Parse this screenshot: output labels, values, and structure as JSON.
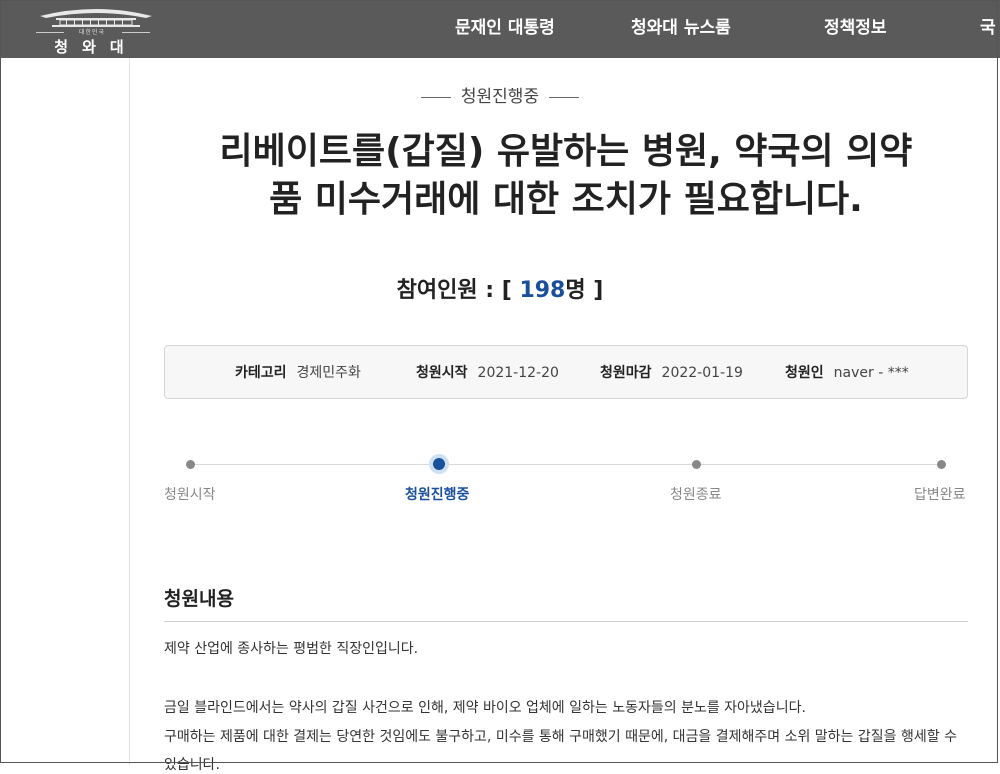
{
  "header": {
    "logo_small": "대한민국",
    "logo_name": "청와대",
    "nav": [
      "문재인 대통령",
      "청와대 뉴스룸",
      "정책정보",
      "국"
    ]
  },
  "petition": {
    "status_label": "청원진행중",
    "title_line1": "리베이트를(갑질) 유발하는 병원, 약국의 의약",
    "title_line2": "품 미수거래에 대한 조치가 필요합니다.",
    "participants_label": "참여인원 : [ ",
    "participants_count": "198",
    "participants_suffix": "명 ]",
    "info": {
      "category_key": "카테고리",
      "category_val": "경제민주화",
      "start_key": "청원시작",
      "start_val": "2021-12-20",
      "end_key": "청원마감",
      "end_val": "2022-01-19",
      "author_key": "청원인",
      "author_val": "naver - ***"
    },
    "steps": [
      "청원시작",
      "청원진행중",
      "청원종료",
      "답변완료"
    ],
    "content_title": "청원내용",
    "content_lines": [
      "제약 산업에 종사하는 평범한 직장인입니다.",
      "금일 블라인드에서는 약사의 갑질 사건으로 인해, 제약 바이오 업체에 일하는 노동자들의 분노를 자아냈습니다.",
      "구매하는 제품에 대한 결제는 당연한 것임에도 불구하고, 미수를 통해 구매했기 때문에, 대금을 결제해주며 소위 말하는 갑질을 행세할 수",
      "있습니다."
    ]
  }
}
